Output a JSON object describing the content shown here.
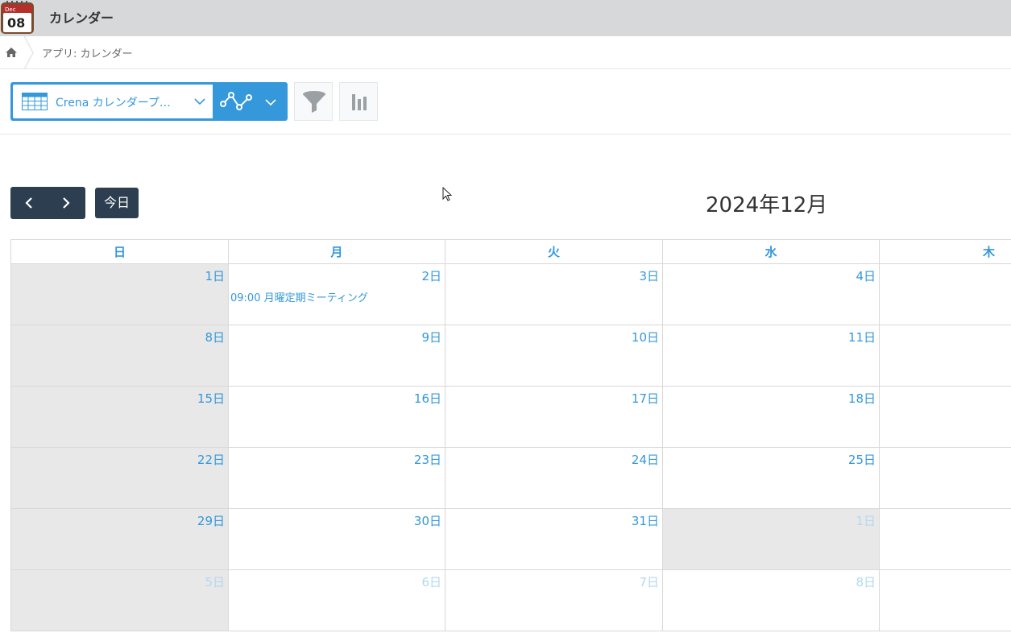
{
  "header": {
    "app_title": "カレンダー",
    "app_icon": {
      "month": "Dec",
      "day": "08"
    }
  },
  "breadcrumb": {
    "text": "アプリ: カレンダー"
  },
  "toolbar": {
    "view_label": "Crena カレンダープ…",
    "accent_color": "#3498db"
  },
  "calendar": {
    "today_label": "今日",
    "month_title": "2024年12月",
    "weekdays": [
      "日",
      "月",
      "火",
      "水",
      "木"
    ],
    "weeks": [
      [
        "1日",
        "2日",
        "3日",
        "4日",
        ""
      ],
      [
        "8日",
        "9日",
        "10日",
        "11日",
        ""
      ],
      [
        "15日",
        "16日",
        "17日",
        "18日",
        ""
      ],
      [
        "22日",
        "23日",
        "24日",
        "25日",
        ""
      ],
      [
        "29日",
        "30日",
        "31日",
        "1日",
        ""
      ],
      [
        "5日",
        "6日",
        "7日",
        "8日",
        ""
      ]
    ],
    "events": {
      "monday_2": "09:00 月曜定期ミーティング"
    }
  }
}
